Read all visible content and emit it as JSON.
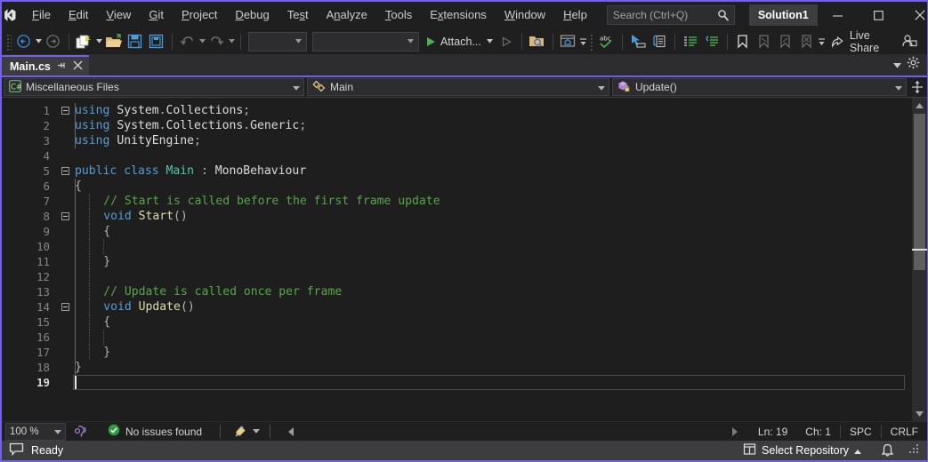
{
  "window": {
    "title_menu": [
      {
        "label": "File",
        "accel": "F"
      },
      {
        "label": "Edit",
        "accel": "E"
      },
      {
        "label": "View",
        "accel": "V"
      },
      {
        "label": "Git",
        "accel": "G"
      },
      {
        "label": "Project",
        "accel": "P"
      },
      {
        "label": "Debug",
        "accel": "D"
      },
      {
        "label": "Test",
        "accel": "s"
      },
      {
        "label": "Analyze",
        "accel": "n"
      },
      {
        "label": "Tools",
        "accel": "T"
      },
      {
        "label": "Extensions",
        "accel": "x"
      },
      {
        "label": "Window",
        "accel": "W"
      },
      {
        "label": "Help",
        "accel": "H"
      }
    ],
    "logo_name": "visual-studio-logo",
    "search_placeholder": "Search (Ctrl+Q)",
    "search_value": "",
    "solution_name": "Solution1",
    "minimize_label": "—",
    "maximize_label": "□",
    "close_label": "✕"
  },
  "toolbar": {
    "navigate_back": "Navigate Backward",
    "navigate_forward": "Navigate Forward",
    "new_item": "New Item",
    "open_file": "Open File",
    "save": "Save",
    "save_all": "Save All",
    "undo": "Undo",
    "redo": "Redo",
    "config_combo": "",
    "platform_combo": "",
    "attach_label": "Attach...",
    "live_share_label": "Live Share"
  },
  "tabs": {
    "items": [
      {
        "label": "Main.cs",
        "pin": "⤓",
        "close": "✕",
        "active": true
      }
    ],
    "overflow_caret": "▾",
    "settings_icon": "gear-icon"
  },
  "navbar": {
    "project": "Miscellaneous Files",
    "project_icon": "csharp-file-icon",
    "type": "Main",
    "type_icon": "class-icon",
    "member": "Update()",
    "member_icon": "method-private-icon",
    "caret": "▾",
    "split_icon": "split-view-icon"
  },
  "editor": {
    "lines": [
      {
        "n": 1,
        "fold": "open",
        "indent": 0,
        "tokens": [
          {
            "t": "using",
            "c": "kw"
          },
          {
            "t": " ",
            "c": "id"
          },
          {
            "t": "System",
            "c": "ns"
          },
          {
            "t": ".",
            "c": "op"
          },
          {
            "t": "Collections",
            "c": "ns"
          },
          {
            "t": ";",
            "c": "op"
          }
        ]
      },
      {
        "n": 2,
        "fold": "",
        "indent": 0,
        "tokens": [
          {
            "t": "using",
            "c": "kw"
          },
          {
            "t": " ",
            "c": "id"
          },
          {
            "t": "System",
            "c": "ns"
          },
          {
            "t": ".",
            "c": "op"
          },
          {
            "t": "Collections",
            "c": "ns"
          },
          {
            "t": ".",
            "c": "op"
          },
          {
            "t": "Generic",
            "c": "ns"
          },
          {
            "t": ";",
            "c": "op"
          }
        ]
      },
      {
        "n": 3,
        "fold": "",
        "indent": 0,
        "tokens": [
          {
            "t": "using",
            "c": "kw"
          },
          {
            "t": " ",
            "c": "id"
          },
          {
            "t": "UnityEngine",
            "c": "ns"
          },
          {
            "t": ";",
            "c": "op"
          }
        ]
      },
      {
        "n": 4,
        "fold": "",
        "indent": 0,
        "tokens": []
      },
      {
        "n": 5,
        "fold": "open",
        "indent": 0,
        "tokens": [
          {
            "t": "public",
            "c": "kw"
          },
          {
            "t": " ",
            "c": "id"
          },
          {
            "t": "class",
            "c": "kw"
          },
          {
            "t": " ",
            "c": "id"
          },
          {
            "t": "Main",
            "c": "typ"
          },
          {
            "t": " : ",
            "c": "op"
          },
          {
            "t": "MonoBehaviour",
            "c": "id"
          }
        ]
      },
      {
        "n": 6,
        "fold": "",
        "indent": 0,
        "tokens": [
          {
            "t": "{",
            "c": "op"
          }
        ]
      },
      {
        "n": 7,
        "fold": "",
        "indent": 1,
        "tokens": [
          {
            "t": "// Start is called before the first frame update",
            "c": "cmt"
          }
        ]
      },
      {
        "n": 8,
        "fold": "open",
        "indent": 1,
        "tokens": [
          {
            "t": "void",
            "c": "kw"
          },
          {
            "t": " ",
            "c": "id"
          },
          {
            "t": "Start",
            "c": "mth"
          },
          {
            "t": "()",
            "c": "op"
          }
        ]
      },
      {
        "n": 9,
        "fold": "",
        "indent": 1,
        "tokens": [
          {
            "t": "{",
            "c": "op"
          }
        ]
      },
      {
        "n": 10,
        "fold": "",
        "indent": 2,
        "tokens": []
      },
      {
        "n": 11,
        "fold": "",
        "indent": 1,
        "tokens": [
          {
            "t": "}",
            "c": "op"
          }
        ]
      },
      {
        "n": 12,
        "fold": "",
        "indent": 1,
        "tokens": []
      },
      {
        "n": 13,
        "fold": "",
        "indent": 1,
        "tokens": [
          {
            "t": "// Update is called once per frame",
            "c": "cmt"
          }
        ]
      },
      {
        "n": 14,
        "fold": "open",
        "indent": 1,
        "tokens": [
          {
            "t": "void",
            "c": "kw"
          },
          {
            "t": " ",
            "c": "id"
          },
          {
            "t": "Update",
            "c": "mth"
          },
          {
            "t": "()",
            "c": "op"
          }
        ]
      },
      {
        "n": 15,
        "fold": "",
        "indent": 1,
        "tokens": [
          {
            "t": "{",
            "c": "op"
          }
        ]
      },
      {
        "n": 16,
        "fold": "",
        "indent": 2,
        "tokens": []
      },
      {
        "n": 17,
        "fold": "",
        "indent": 1,
        "tokens": [
          {
            "t": "}",
            "c": "op"
          }
        ]
      },
      {
        "n": 18,
        "fold": "",
        "indent": 0,
        "tokens": [
          {
            "t": "}",
            "c": "op"
          }
        ]
      },
      {
        "n": 19,
        "fold": "",
        "indent": 0,
        "tokens": [],
        "current": true
      }
    ]
  },
  "editor_status": {
    "zoom": "100 %",
    "zoom_caret": "▾",
    "issues_text": "No issues found",
    "issues_icon": "check-circle-icon",
    "screen_reader_icon": "screen-reader-icon",
    "broom_icon": "code-cleanup-icon",
    "broom_caret": "▾",
    "scroll_left": "◂",
    "scroll_right": "▸",
    "line": "Ln: 19",
    "col": "Ch: 1",
    "spaces": "SPC",
    "eol": "CRLF"
  },
  "statusbar": {
    "ready_text": "Ready",
    "ready_icon": "feedback-icon",
    "repository_text": "Select Repository",
    "repository_icon": "repository-icon",
    "repository_caret": "▴",
    "bell_icon": "notifications-icon",
    "resize_icon": "resize-grip-icon"
  },
  "colors": {
    "accent": "#7160e8",
    "editor_bg": "#1e1e1e",
    "chrome_bg": "#1f1f1f",
    "keyword": "#569cd6",
    "type": "#4ec9b0",
    "comment": "#57a64a",
    "method": "#dcdcaa",
    "text": "#dcdcdc",
    "status_bg": "#3d3d40"
  }
}
